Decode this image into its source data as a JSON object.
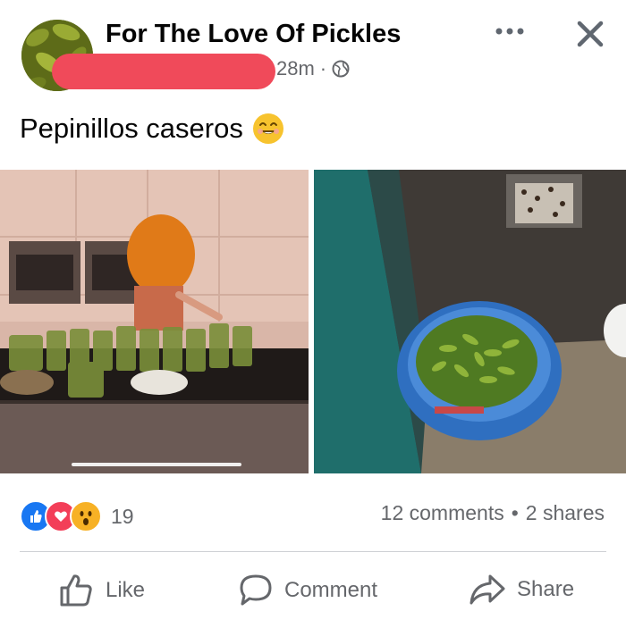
{
  "post": {
    "group_name": "For The Love Of Pickles",
    "time": "28m",
    "separator": "·",
    "privacy_icon": "globe-icon",
    "caption": "Pepinillos caseros",
    "caption_emoji": "smiling-face-emoji"
  },
  "header_actions": {
    "more_icon": "more-dots-icon",
    "close_icon": "close-icon"
  },
  "reactions": {
    "types": [
      "like",
      "love",
      "wow"
    ],
    "count": "19",
    "comments": "12 comments",
    "dot": "•",
    "shares": "2 shares"
  },
  "actions": {
    "like": "Like",
    "comment": "Comment",
    "share": "Share"
  },
  "colors": {
    "like_blue": "#1877f2",
    "love_red": "#f33e58",
    "wow_yellow": "#f7b125",
    "secondary_text": "#65676b"
  }
}
